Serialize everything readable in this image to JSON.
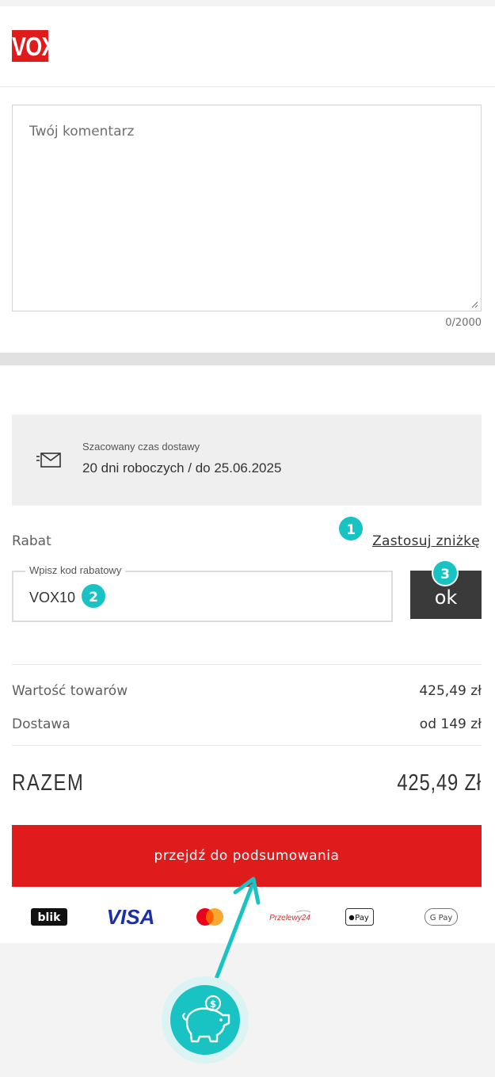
{
  "brand": {
    "logo_text": "VOX",
    "color": "#e01b1b"
  },
  "comment": {
    "placeholder": "Twój komentarz",
    "counter": "0/2000"
  },
  "delivery": {
    "icon": "envelope-icon",
    "label": "Szacowany czas dostawy",
    "value": "20 dni roboczych / do 25.06.2025"
  },
  "discount": {
    "section_label": "Rabat",
    "apply_link": "Zastosuj zniżkę",
    "field_legend": "Wpisz kod rabatowy",
    "field_value": "VOX10",
    "submit_label": "ok"
  },
  "summary": {
    "rows": [
      {
        "label": "Wartość towarów",
        "value": "425,49 zł"
      },
      {
        "label": "Dostawa",
        "value": "od 149 zł"
      }
    ],
    "total_label": "RAZEM",
    "total_value": "425,49 Zł"
  },
  "cta": {
    "label": "przejdź do podsumowania",
    "color": "#e01b1b"
  },
  "payments": [
    {
      "name": "blik-logo",
      "text": "blik"
    },
    {
      "name": "visa-logo",
      "text": "VISA"
    },
    {
      "name": "mastercard-logo",
      "text": ""
    },
    {
      "name": "przelewy24-logo",
      "text": "Przelewy24"
    },
    {
      "name": "apple-pay-logo",
      "text": "Pay"
    },
    {
      "name": "google-pay-logo",
      "text": "G Pay"
    }
  ],
  "annotations": {
    "accent": "#19c3c3",
    "badges": [
      "1",
      "2",
      "3"
    ],
    "illustration_icon": "piggy-bank-icon",
    "coin_symbol": "$"
  }
}
